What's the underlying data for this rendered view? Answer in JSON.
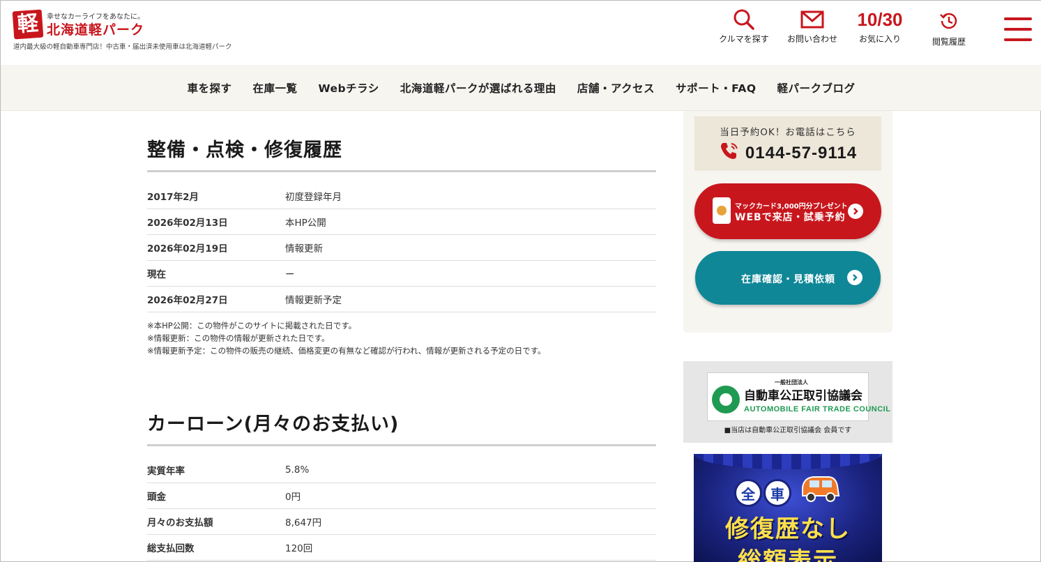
{
  "header": {
    "catch": "幸せなカーライフをあなたに。",
    "logo_char": "軽",
    "logo_name": "北海道軽パーク",
    "sub": "道内最大級の軽自動車専門店！中古車・届出済未使用車は北海道軽パーク",
    "nav": {
      "search": "クルマを探す",
      "contact": "お問い合わせ",
      "favorites": "お気に入り",
      "favorites_count": "10",
      "favorites_total": "/30",
      "history": "閲覧履歴"
    },
    "icons": {
      "search": "search-icon",
      "contact": "mail-icon",
      "history": "history-icon",
      "menu": "hamburger-icon"
    },
    "accent_color": "#c8161d"
  },
  "global_nav": [
    "車を探す",
    "在庫一覧",
    "Webチラシ",
    "北海道軽パークが選ばれる理由",
    "店舗・アクセス",
    "サポート・FAQ",
    "軽パークブログ"
  ],
  "maintenance": {
    "title": "整備・点検・修復履歴",
    "rows": [
      {
        "key": "2017年2月",
        "value": "初度登録年月"
      },
      {
        "key": "2026年02月13日",
        "value": "本HP公開"
      },
      {
        "key": "2026年02月19日",
        "value": "情報更新"
      },
      {
        "key": "現在",
        "value": "ー"
      },
      {
        "key": "2026年02月27日",
        "value": "情報更新予定"
      }
    ],
    "notes": [
      "※本HP公開：この物件がこのサイトに掲載された日です。",
      "※情報更新：この物件の情報が更新された日です。",
      "※情報更新予定：この物件の販売の継続、価格変更の有無など確認が行われ、情報が更新される予定の日です。"
    ]
  },
  "loan": {
    "title": "カーローン(月々のお支払い)",
    "rows": [
      {
        "key": "実質年率",
        "value": "5.8%"
      },
      {
        "key": "頭金",
        "value": "0円"
      },
      {
        "key": "月々のお支払額",
        "value": "8,647円"
      },
      {
        "key": "総支払回数",
        "value": "120回"
      }
    ]
  },
  "sidebar": {
    "tel_caption": "当日予約OK！お電話はこちら",
    "tel_number": "0144-57-9114",
    "web_btn_line1": "マックカード3,000円分プレゼント",
    "web_btn_line2": "WEBで来店・試乗予約",
    "estimate_btn": "在庫確認・見積依頼",
    "web_btn_color": "#c8161d",
    "estimate_btn_color": "#0f8797"
  },
  "council": {
    "small": "一般社団法人",
    "name_ja": "自動車公正取引協議会",
    "name_en": "AUTOMOBILE FAIR TRADE COUNCIL",
    "caption": "■当店は自動車公正取引協議会 会員です"
  },
  "banner": {
    "circle1": "全",
    "circle2": "車",
    "line1": "修復歴なし",
    "line2": "総額表示"
  }
}
